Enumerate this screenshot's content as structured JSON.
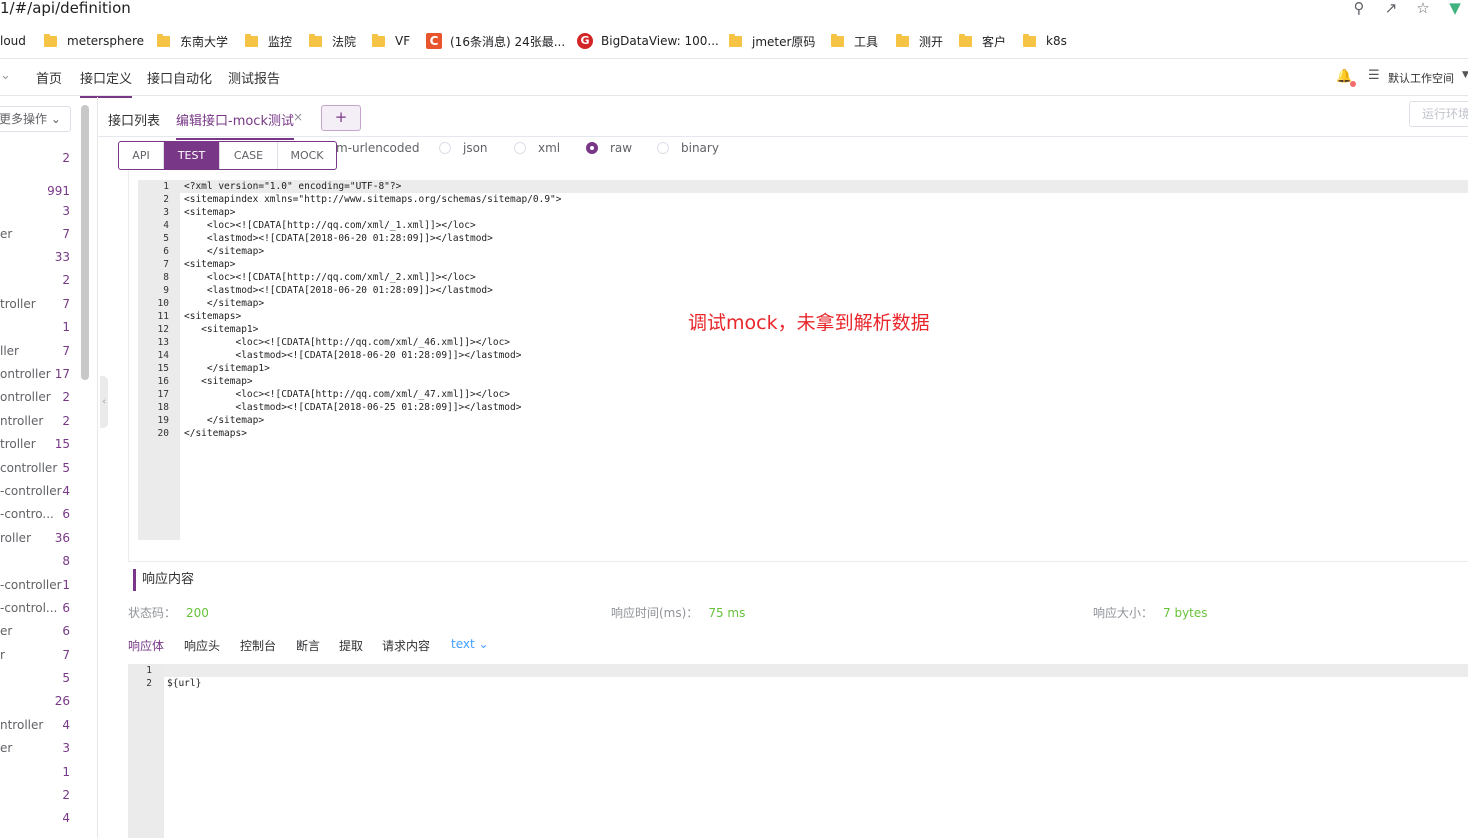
{
  "browser": {
    "url": "1/#/api/definition",
    "bookmarks": [
      {
        "label": "loud",
        "icon": "none"
      },
      {
        "label": "metersphere",
        "icon": "folder-icon"
      },
      {
        "label": "东南大学",
        "icon": "folder-icon"
      },
      {
        "label": "监控",
        "icon": "folder-icon"
      },
      {
        "label": "法院",
        "icon": "folder-icon"
      },
      {
        "label": "VF",
        "icon": "folder-icon"
      },
      {
        "label": "(16条消息) 24张最...",
        "icon": "csdn-icon"
      },
      {
        "label": "BigDataView: 100...",
        "icon": "gitee-icon"
      },
      {
        "label": "jmeter原码",
        "icon": "folder-icon"
      },
      {
        "label": "工具",
        "icon": "folder-icon"
      },
      {
        "label": "测开",
        "icon": "folder-icon"
      },
      {
        "label": "客户",
        "icon": "folder-icon"
      },
      {
        "label": "k8s",
        "icon": "folder-icon"
      }
    ]
  },
  "header": {
    "nav": [
      "首页",
      "接口定义",
      "接口自动化",
      "测试报告"
    ],
    "active_nav": "接口定义",
    "workspace": "默认工作空间"
  },
  "tree": {
    "more_ops": "更多操作",
    "rows": [
      {
        "name": "",
        "count": "2"
      },
      {
        "name": "",
        "count": "991"
      },
      {
        "name": "",
        "count": "3"
      },
      {
        "name": "er",
        "count": "7"
      },
      {
        "name": "",
        "count": "33"
      },
      {
        "name": "",
        "count": "2"
      },
      {
        "name": "troller",
        "count": "7"
      },
      {
        "name": "",
        "count": "1"
      },
      {
        "name": "ller",
        "count": "7"
      },
      {
        "name": "ontroller",
        "count": "17"
      },
      {
        "name": "ontroller",
        "count": "2"
      },
      {
        "name": "ntroller",
        "count": "2"
      },
      {
        "name": "troller",
        "count": "15"
      },
      {
        "name": "controller",
        "count": "5"
      },
      {
        "name": "-controller",
        "count": "4"
      },
      {
        "name": "-contro...",
        "count": "6"
      },
      {
        "name": "roller",
        "count": "36"
      },
      {
        "name": "",
        "count": "8"
      },
      {
        "name": "-controller",
        "count": "1"
      },
      {
        "name": "-control...",
        "count": "6"
      },
      {
        "name": "er",
        "count": "6"
      },
      {
        "name": "r",
        "count": "7"
      },
      {
        "name": "",
        "count": "5"
      },
      {
        "name": "",
        "count": "26"
      },
      {
        "name": "ntroller",
        "count": "4"
      },
      {
        "name": "er",
        "count": "3"
      },
      {
        "name": "",
        "count": "1"
      },
      {
        "name": "",
        "count": "2"
      },
      {
        "name": "",
        "count": "4"
      }
    ]
  },
  "tabs": {
    "list": "接口列表",
    "edit": "编辑接口-mock测试",
    "add": "+",
    "run_env": "运行环境"
  },
  "modes": [
    "API",
    "TEST",
    "CASE",
    "MOCK"
  ],
  "active_mode": "TEST",
  "body_types": [
    {
      "label": "m-urlencoded",
      "selected": false
    },
    {
      "label": "json",
      "selected": false
    },
    {
      "label": "xml",
      "selected": false
    },
    {
      "label": "raw",
      "selected": true
    },
    {
      "label": "binary",
      "selected": false
    }
  ],
  "request_code": [
    "<?xml version=\"1.0\" encoding=\"UTF-8\"?>",
    "<sitemapindex xmlns=\"http://www.sitemaps.org/schemas/sitemap/0.9\">",
    "<sitemap>",
    "    <loc><![CDATA[http://qq.com/xml/_1.xml]]></loc>",
    "    <lastmod><![CDATA[2018-06-20 01:28:09]]></lastmod>",
    "    </sitemap>",
    "<sitemap>",
    "    <loc><![CDATA[http://qq.com/xml/_2.xml]]></loc>",
    "    <lastmod><![CDATA[2018-06-20 01:28:09]]></lastmod>",
    "    </sitemap>",
    "<sitemaps>",
    "   <sitemap1>",
    "         <loc><![CDATA[http://qq.com/xml/_46.xml]]></loc>",
    "         <lastmod><![CDATA[2018-06-20 01:28:09]]></lastmod>",
    "    </sitemap1>",
    "   <sitemap>",
    "         <loc><![CDATA[http://qq.com/xml/_47.xml]]></loc>",
    "         <lastmod><![CDATA[2018-06-25 01:28:09]]></lastmod>",
    "    </sitemap>",
    "</sitemaps>"
  ],
  "annotation": "调试mock，未拿到解析数据",
  "response": {
    "title": "响应内容",
    "status_label": "状态码：",
    "status_value": "200",
    "time_label": "响应时间(ms)：",
    "time_value": "75 ms",
    "size_label": "响应大小：",
    "size_value": "7 bytes",
    "tabs": [
      "响应体",
      "响应头",
      "控制台",
      "断言",
      "提取",
      "请求内容"
    ],
    "format": "text",
    "code": [
      "",
      "${url}"
    ]
  },
  "colors": {
    "brand": "#783887",
    "success": "#67c23a",
    "annotation": "#e8262b",
    "link": "#409eff"
  }
}
